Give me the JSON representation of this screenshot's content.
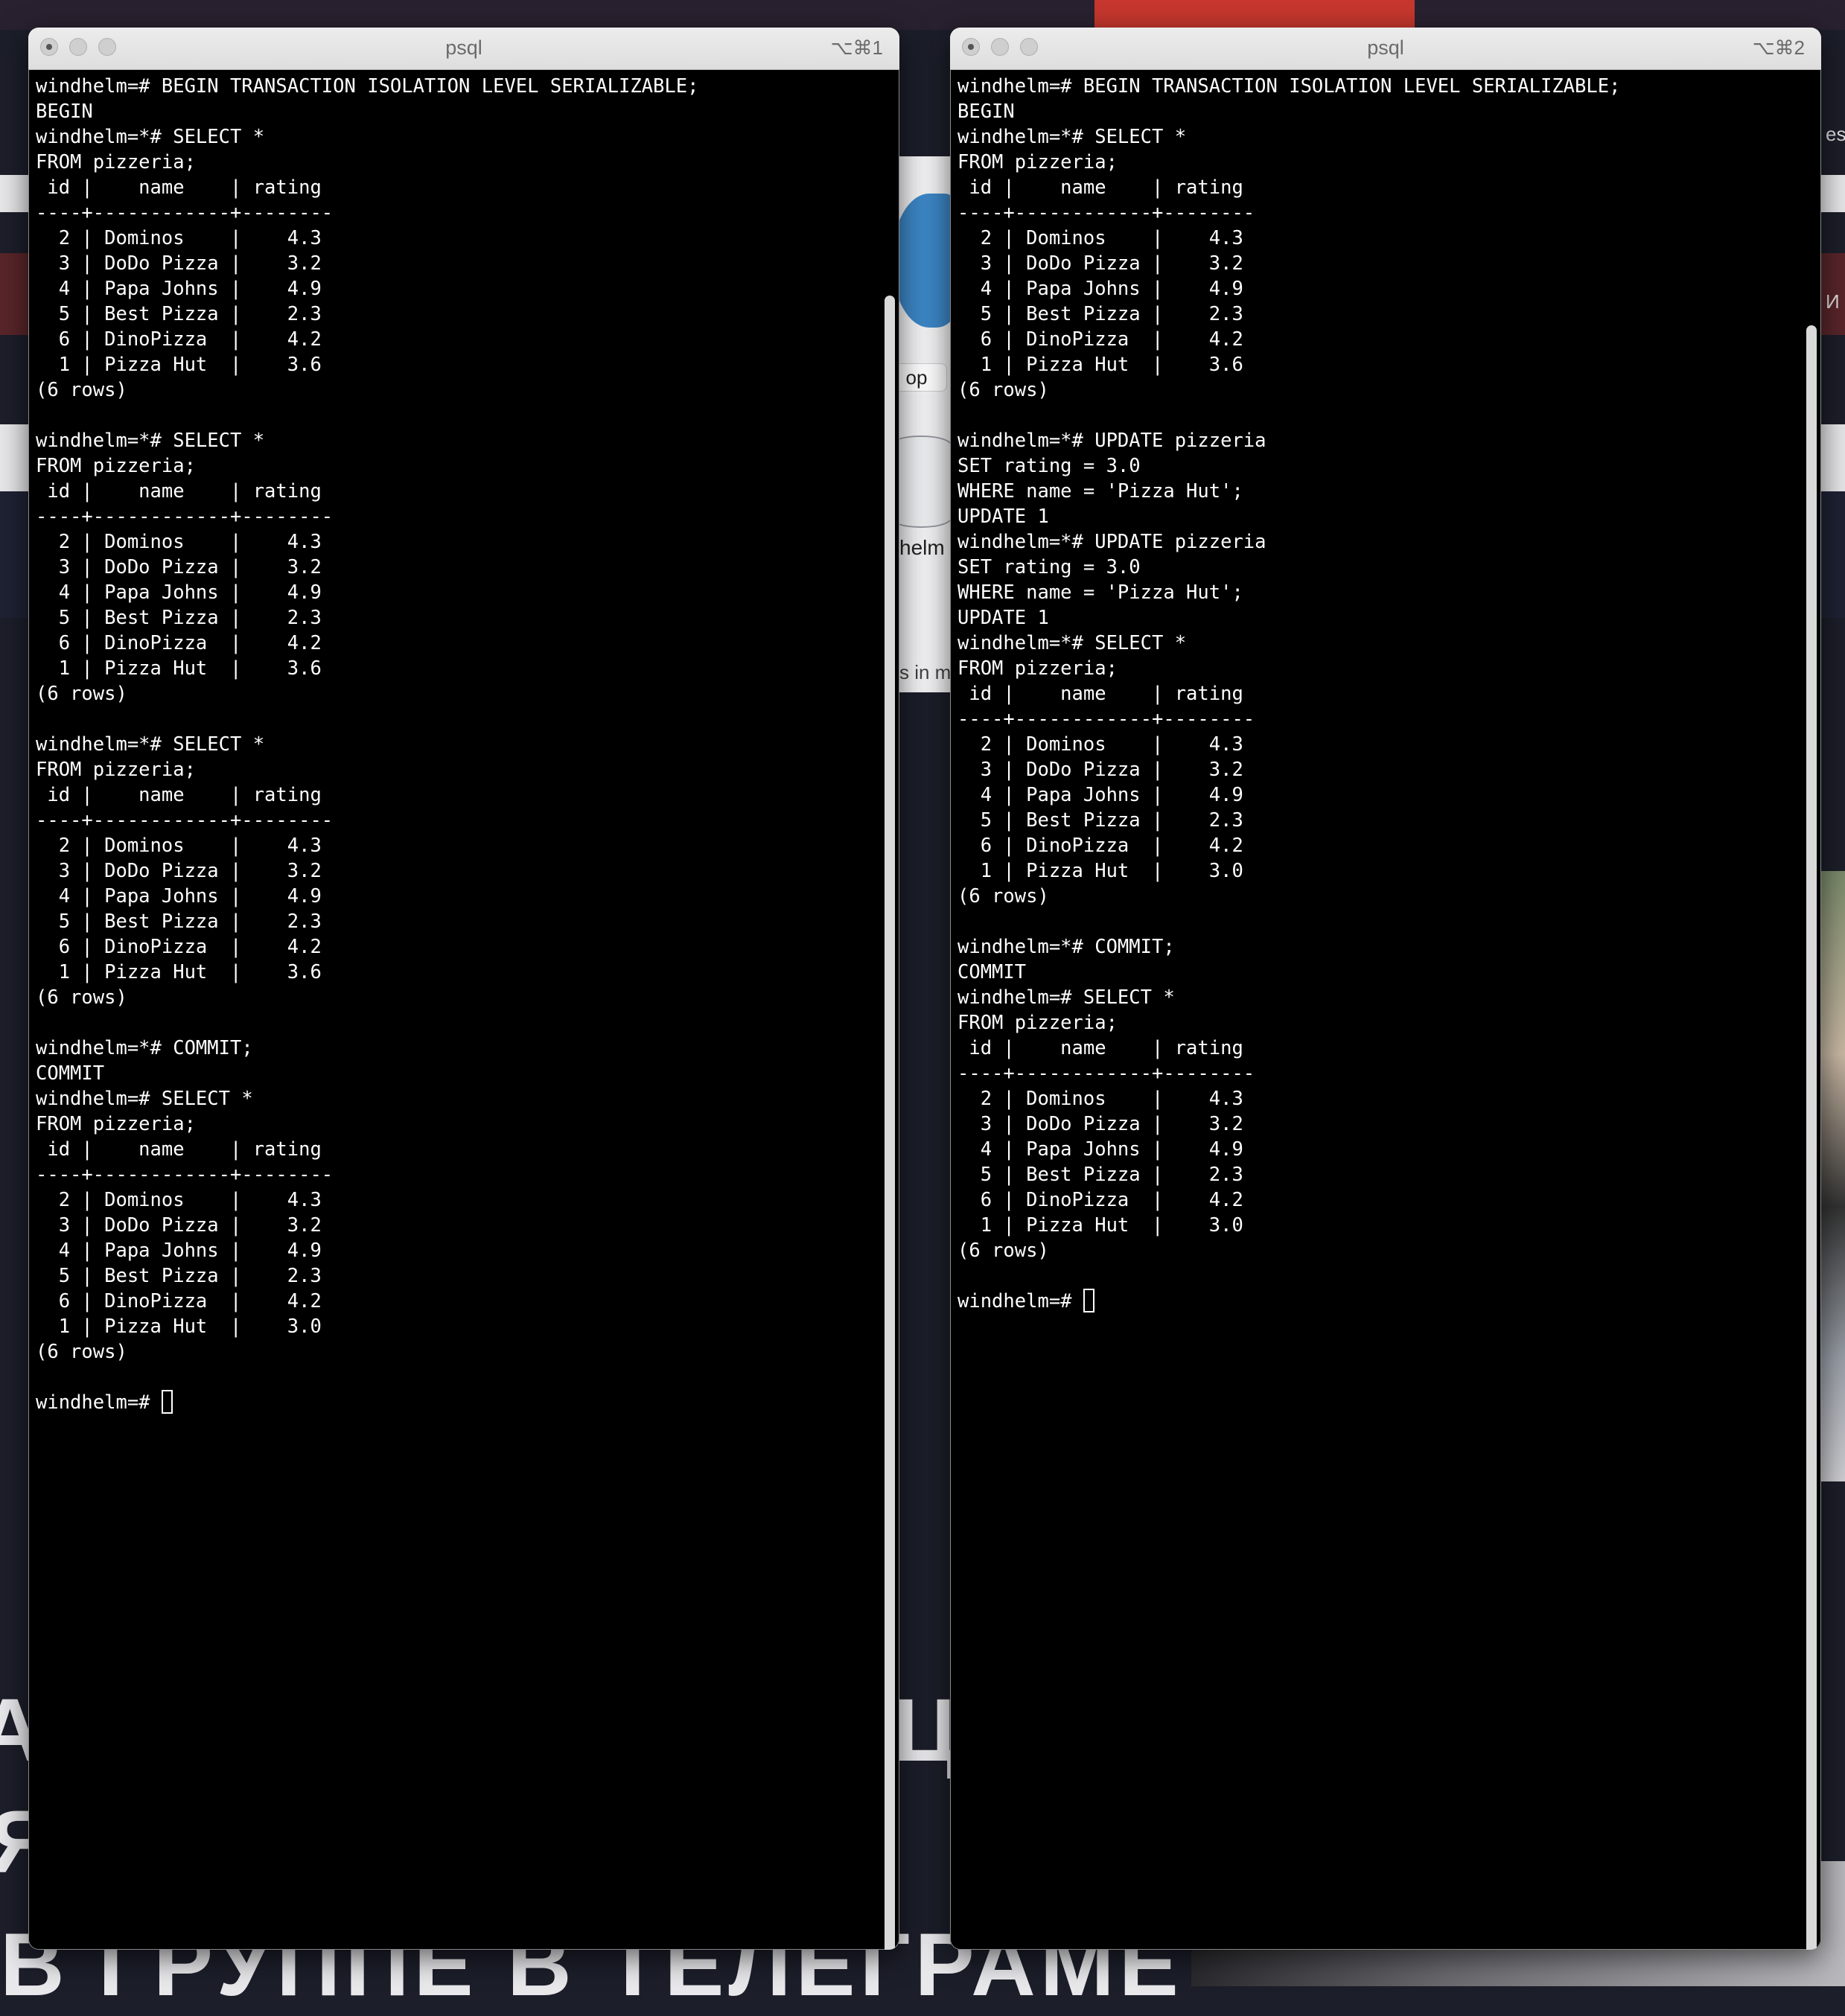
{
  "background": {
    "popup_button": "op",
    "popup_label": "helm",
    "popup_text": "s in m",
    "big_text_bottom": "В ГРУППЕ В ТЕЛЕГРАМЕ",
    "big_text_left_1": "А",
    "big_text_left_2": "Я",
    "big_text_right": "ЦИ",
    "side_text_1": "ese",
    "side_text_2": "И"
  },
  "windows": [
    {
      "title": "psql",
      "shortcut": "⌥⌘1",
      "lines": [
        "windhelm=# BEGIN TRANSACTION ISOLATION LEVEL SERIALIZABLE;",
        "BEGIN",
        "windhelm=*# SELECT *",
        "FROM pizzeria;",
        " id |    name    | rating",
        "----+------------+--------",
        "  2 | Dominos    |    4.3",
        "  3 | DoDo Pizza |    3.2",
        "  4 | Papa Johns |    4.9",
        "  5 | Best Pizza |    2.3",
        "  6 | DinoPizza  |    4.2",
        "  1 | Pizza Hut  |    3.6",
        "(6 rows)",
        "",
        "windhelm=*# SELECT *",
        "FROM pizzeria;",
        " id |    name    | rating",
        "----+------------+--------",
        "  2 | Dominos    |    4.3",
        "  3 | DoDo Pizza |    3.2",
        "  4 | Papa Johns |    4.9",
        "  5 | Best Pizza |    2.3",
        "  6 | DinoPizza  |    4.2",
        "  1 | Pizza Hut  |    3.6",
        "(6 rows)",
        "",
        "windhelm=*# SELECT *",
        "FROM pizzeria;",
        " id |    name    | rating",
        "----+------------+--------",
        "  2 | Dominos    |    4.3",
        "  3 | DoDo Pizza |    3.2",
        "  4 | Papa Johns |    4.9",
        "  5 | Best Pizza |    2.3",
        "  6 | DinoPizza  |    4.2",
        "  1 | Pizza Hut  |    3.6",
        "(6 rows)",
        "",
        "windhelm=*# COMMIT;",
        "COMMIT",
        "windhelm=# SELECT *",
        "FROM pizzeria;",
        " id |    name    | rating",
        "----+------------+--------",
        "  2 | Dominos    |    4.3",
        "  3 | DoDo Pizza |    3.2",
        "  4 | Papa Johns |    4.9",
        "  5 | Best Pizza |    2.3",
        "  6 | DinoPizza  |    4.2",
        "  1 | Pizza Hut  |    3.0",
        "(6 rows)",
        ""
      ],
      "prompt": "windhelm=# "
    },
    {
      "title": "psql",
      "shortcut": "⌥⌘2",
      "lines": [
        "windhelm=# BEGIN TRANSACTION ISOLATION LEVEL SERIALIZABLE;",
        "BEGIN",
        "windhelm=*# SELECT *",
        "FROM pizzeria;",
        " id |    name    | rating",
        "----+------------+--------",
        "  2 | Dominos    |    4.3",
        "  3 | DoDo Pizza |    3.2",
        "  4 | Papa Johns |    4.9",
        "  5 | Best Pizza |    2.3",
        "  6 | DinoPizza  |    4.2",
        "  1 | Pizza Hut  |    3.6",
        "(6 rows)",
        "",
        "windhelm=*# UPDATE pizzeria",
        "SET rating = 3.0",
        "WHERE name = 'Pizza Hut';",
        "UPDATE 1",
        "windhelm=*# UPDATE pizzeria",
        "SET rating = 3.0",
        "WHERE name = 'Pizza Hut';",
        "UPDATE 1",
        "windhelm=*# SELECT *",
        "FROM pizzeria;",
        " id |    name    | rating",
        "----+------------+--------",
        "  2 | Dominos    |    4.3",
        "  3 | DoDo Pizza |    3.2",
        "  4 | Papa Johns |    4.9",
        "  5 | Best Pizza |    2.3",
        "  6 | DinoPizza  |    4.2",
        "  1 | Pizza Hut  |    3.0",
        "(6 rows)",
        "",
        "windhelm=*# COMMIT;",
        "COMMIT",
        "windhelm=# SELECT *",
        "FROM pizzeria;",
        " id |    name    | rating",
        "----+------------+--------",
        "  2 | Dominos    |    4.3",
        "  3 | DoDo Pizza |    3.2",
        "  4 | Papa Johns |    4.9",
        "  5 | Best Pizza |    2.3",
        "  6 | DinoPizza  |    4.2",
        "  1 | Pizza Hut  |    3.0",
        "(6 rows)",
        ""
      ],
      "prompt": "windhelm=# "
    }
  ]
}
